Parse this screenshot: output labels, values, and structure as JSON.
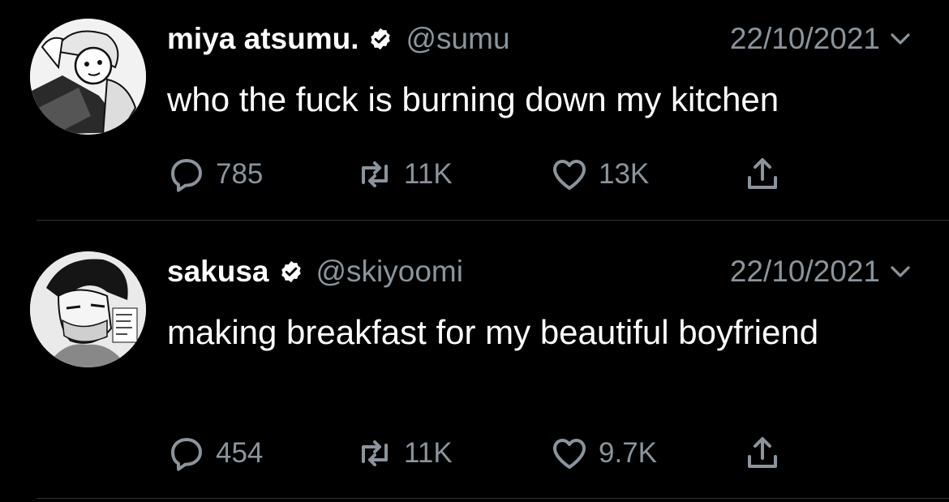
{
  "colors": {
    "background": "#000000",
    "text": "#ffffff",
    "secondary": "#8b949c",
    "divider": "#2f3336"
  },
  "tweets": [
    {
      "display_name": "miya atsumu.",
      "handle": "@sumu",
      "date": "22/10/2021",
      "text": "who the fuck is burning down my kitchen",
      "replies": "785",
      "retweets": "11K",
      "likes": "13K",
      "avatar_icon": "manga-avatar",
      "verified_icon": "verified-badge-icon"
    },
    {
      "display_name": "sakusa",
      "handle": "@skiyoomi",
      "date": "22/10/2021",
      "text": "making breakfast for my beautiful boyfriend",
      "replies": "454",
      "retweets": "11K",
      "likes": "9.7K",
      "avatar_icon": "manga-avatar",
      "verified_icon": "verified-badge-icon"
    }
  ]
}
